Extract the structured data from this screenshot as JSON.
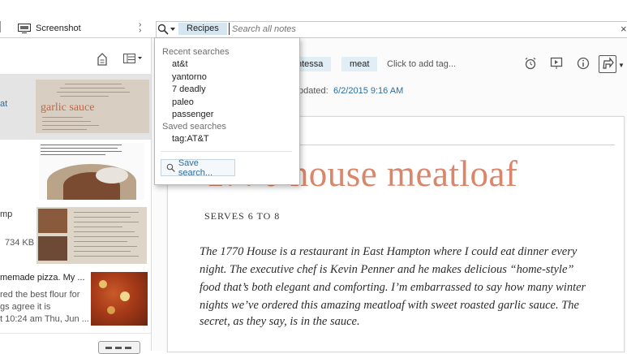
{
  "toolbar": {
    "screenshot_label": "Screenshot",
    "search_scope": "Recipes",
    "search_placeholder": "Search all notes"
  },
  "search_dropdown": {
    "recent_heading": "Recent searches",
    "recent": [
      "at&t",
      "yantorno",
      "7 deadly",
      "paleo",
      "passenger"
    ],
    "saved_heading": "Saved searches",
    "saved": [
      "tag:AT&T"
    ],
    "save_button": "Save search..."
  },
  "note_list": {
    "notes": [
      {
        "title_fragment": "at",
        "thumb_caption": "garlic sauce"
      },
      {
        "title_fragment": "mp",
        "size": "734 KB"
      },
      {
        "title": "memade pizza. My ...",
        "snippet1": "red the best flour for",
        "snippet2": "gs agree it is",
        "meta": "t 10:24 am Thu, Jun ..."
      }
    ]
  },
  "note": {
    "tags": [
      "ntessa",
      "meat"
    ],
    "add_tag": "Click to add tag...",
    "updated_label": "pdated:",
    "updated_value": "6/2/2015 9:16 AM",
    "title": "1770 house meatloaf",
    "serves": "SERVES 6 TO 8",
    "body_lines": [
      "The 1770 House is a restaurant in East Hampton where I could eat dinner every",
      "night. The executive chef is Kevin Penner and he makes delicious “home-style”",
      "food that’s both elegant and comforting. I’m embarrassed to say how many winter",
      "nights we’ve ordered this amazing meatloaf with sweet roasted garlic sauce. The",
      "secret, as they say, is in the sauce."
    ]
  },
  "colors": {
    "accent_blue": "#2b6ea3",
    "tag_bg": "#e1eef6",
    "title_salmon": "#d9866a"
  },
  "icons": [
    "screen-icon",
    "search-icon",
    "chevron-down-icon",
    "close-icon",
    "shortcut-icon",
    "view-options-icon",
    "alarm-icon",
    "present-icon",
    "info-icon",
    "share-icon",
    "magnifier-icon"
  ]
}
